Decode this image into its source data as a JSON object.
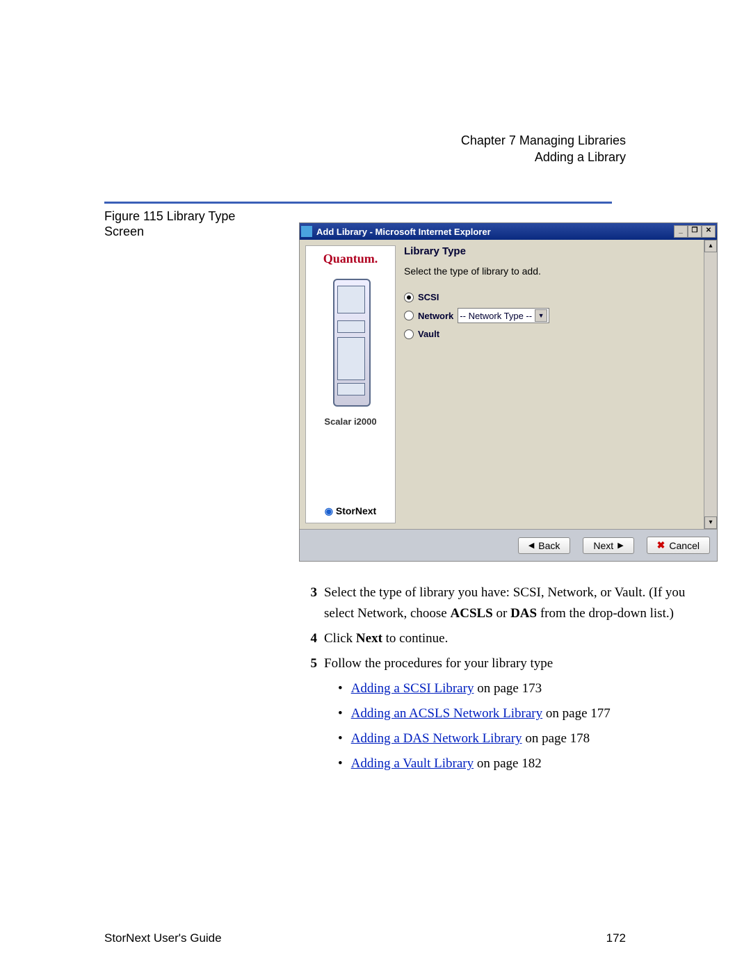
{
  "header": {
    "chapter": "Chapter 7  Managing Libraries",
    "section": "Adding a Library"
  },
  "figure_label": "Figure 115  Library Type Screen",
  "window": {
    "title": "Add Library - Microsoft Internet Explorer",
    "min": "_",
    "restore": "❐",
    "close": "✕",
    "sidebar_brand": "Quantum.",
    "device_label": "Scalar i2000",
    "stor_next": "StorNext",
    "content_title": "Library Type",
    "content_intro": "Select the type of library to add.",
    "radio_scsi": "SCSI",
    "radio_network": "Network",
    "network_placeholder": "-- Network Type --",
    "radio_vault": "Vault",
    "btn_back": "Back",
    "btn_next": "Next",
    "btn_cancel": "Cancel",
    "scroll_up": "▴",
    "scroll_down": "▾"
  },
  "steps": {
    "s3": {
      "n": "3",
      "text_a": "Select the type of library you have: SCSI, Network, or Vault. (If you select Network, choose ",
      "b1": "ACSLS",
      "mid": " or ",
      "b2": "DAS",
      "text_b": " from the drop-down list.)"
    },
    "s4": {
      "n": "4",
      "text_a": "Click ",
      "b1": "Next",
      "text_b": " to continue."
    },
    "s5": {
      "n": "5",
      "text": "Follow the procedures for your library type"
    }
  },
  "links": {
    "l1": {
      "link": "Adding a SCSI Library",
      "tail": " on page  173"
    },
    "l2": {
      "link": "Adding an ACSLS Network Library",
      "tail": " on page  177"
    },
    "l3": {
      "link": "Adding a DAS Network Library",
      "tail": " on page  178"
    },
    "l4": {
      "link": "Adding a Vault Library",
      "tail": " on page  182"
    }
  },
  "footer": {
    "left": "StorNext User's Guide",
    "right": "172"
  }
}
